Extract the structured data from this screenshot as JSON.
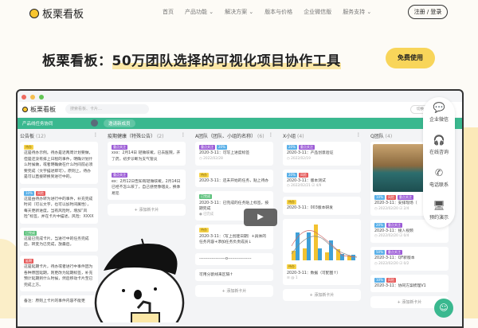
{
  "nav": {
    "brand": "板栗看板",
    "items": [
      "首页",
      "产品功能 ⌄",
      "解决方案 ⌄",
      "版本与价格",
      "企业微信版",
      "服务支持 ⌄"
    ],
    "login": "注册 / 登录"
  },
  "hero": {
    "title_a": "板栗看板：",
    "title_b": "50万团队选择的可视化项目协作工具",
    "cta": "免费使用"
  },
  "app": {
    "brand": "板栗看板",
    "search_placeholder": "搜索看板、卡片…",
    "switch": "切换看板",
    "board": "产品线任务协同",
    "invite": "邀请新成员",
    "add_card": "+ 添加新卡片",
    "columns": [
      {
        "title": "公告板",
        "count": "(12)",
        "cards": [
          {
            "tags": [
              [
                "待办",
                "y"
              ]
            ],
            "text": "这是待办示例。待办是近两周计划要做，但是还没有排上日程的事件。明确计划什么时候做，或者明确做在什么时间前必须要完成（文字描述即可），原则上，待办是可以直接转换到进行中的。"
          },
          {
            "tags": [
              [
                "10%",
                "b"
              ],
              [
                "风险",
                "r"
              ]
            ],
            "text": "这是由待办转为进行中的事件，补充完成时间（可以文字，也可以加时间属性），每天更新进度。当有风险时，增加“风险”标签，并在卡片中描述。风险：XXXX"
          },
          {
            "tags": [
              [
                "已完成",
                "g"
              ]
            ],
            "text": "这是已完成卡片，当进行中的任务完成后，转变为已完成，放最后。"
          },
          {
            "tags": [
              [
                "延期",
                "r"
              ]
            ],
            "text": "这是延期卡片，待办或者进行中事件因为各种原因延期，则更改为延期标签，补充预计延期到什么时候，然后移动卡片至已完成上方。"
          },
          {
            "tags": [],
            "text": "备注：原则上卡片的事件内容不能更"
          }
        ]
      },
      {
        "title": "疫期健康（特殊公告）",
        "count": "(2)",
        "cards": [
          {
            "tags": [
              [
                "重点关注",
                "p"
              ]
            ],
            "text": "xxx：2月14日 轻微咳嗽，已去医院，开了药，初步诊断为支气管炎"
          },
          {
            "tags": [
              [
                "重点关注",
                "p"
              ]
            ],
            "text": "ex：2月12日告知有轻微咳嗽，2月14日已经不怎么咳了，自己感觉像咽炎，换季易犯"
          }
        ],
        "add": true
      },
      {
        "title": "A团队（团队、小组的名称）",
        "count": "(6)",
        "cards": [
          {
            "tags": [
              [
                "重点关注",
                "p"
              ],
              [
                "20%",
                "b"
              ]
            ],
            "text": "2020-3-11：可写上进度标签",
            "meta": "◷ 2022/02/28"
          },
          {
            "tags": [
              [
                "待办",
                "y"
              ]
            ],
            "text": "2020-3-11：还未开始的任务，贴上待办"
          },
          {
            "tags": [
              [
                "已完成",
                "g"
              ]
            ],
            "text": "2020-3-11：已完成的任务贴上标签，按期完成",
            "meta": "● 已完成"
          },
          {
            "tags": [
              [
                "待办",
                "y"
              ]
            ],
            "text": "2020-3-11：（写上创建日期）+具体的任务内容+添加任务负责成员↓"
          },
          {
            "tags": [],
            "text": "-------------------o-----------------"
          },
          {
            "tags": [],
            "text": "可用分割线来区隔↑"
          }
        ],
        "add": true
      },
      {
        "title": "X小组",
        "count": "(4)",
        "cards": [
          {
            "tags": [
              [
                "20%",
                "b"
              ],
              [
                "重点关注",
                "p"
              ]
            ],
            "text": "2020-3-11：产品创意验证",
            "meta": "◷ 2022/02/19"
          },
          {
            "tags": [
              [
                "20%",
                "b"
              ],
              [
                "风险",
                "r"
              ]
            ],
            "text": "2020-3-11：版本测试",
            "meta": "◷ 2022/02/21 ☑ 4/9"
          },
          {
            "tags": [
              [
                "待办",
                "y"
              ]
            ],
            "text": "2020-3-11：003版本研发"
          },
          {
            "chart": true,
            "tags": [
              [
                "待办",
                "y"
              ]
            ],
            "text": "2020-3-11：数据（可配图↑）",
            "meta": "☰ @ 1"
          }
        ],
        "add": true
      },
      {
        "title": "Q团队",
        "count": "(4)",
        "cards": [
          {
            "photo": true,
            "tags": [
              [
                "10%",
                "b"
              ],
              [
                "风险",
                "r"
              ],
              [
                "重点关注",
                "p"
              ]
            ],
            "text": "2020-3-11：安排现场（",
            "meta": "◷ 2022/02/20 ☑ 2/4"
          },
          {
            "tags": [
              [
                "20%",
                "b"
              ],
              [
                "重点关注",
                "p"
              ]
            ],
            "text": "2020-3-11：接入视频",
            "meta": "◷ 2022/02/20 ☑ 0/4"
          },
          {
            "tags": [
              [
                "50%",
                "b"
              ],
              [
                "重点关注",
                "p"
              ]
            ],
            "text": "2020-3-11：QF新版本",
            "meta": "◷ 2022/02/20 ☑ 0/2"
          },
          {
            "tags": [
              [
                "10%",
                "b"
              ],
              [
                "风险",
                "r"
              ]
            ],
            "text": "2020-3-11：协同方案梳理V1"
          }
        ],
        "add": true
      }
    ]
  },
  "side": [
    {
      "icon": "wechat-icon",
      "g": "💬",
      "label": "企业微信"
    },
    {
      "icon": "headset-icon",
      "g": "🎧",
      "label": "在线咨询"
    },
    {
      "icon": "phone-icon",
      "g": "✆",
      "label": "电话联系"
    },
    {
      "icon": "monitor-icon",
      "g": "🖥",
      "label": "预约演示"
    }
  ],
  "colors": {
    "green": "#3ab88f",
    "yellow": "#f8d55a"
  }
}
